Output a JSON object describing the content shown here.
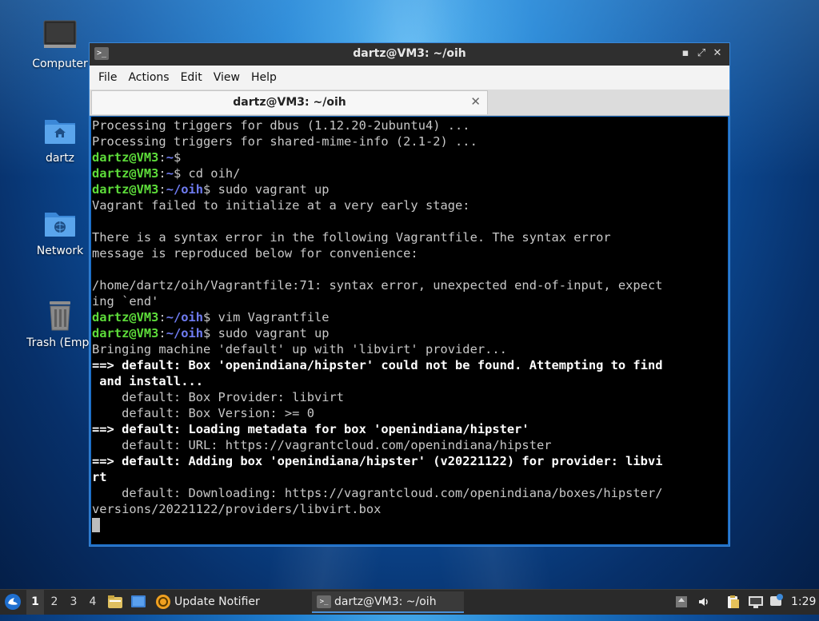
{
  "desktop": {
    "icons": [
      {
        "label": "Computer"
      },
      {
        "label": "dartz"
      },
      {
        "label": "Network"
      },
      {
        "label": "Trash (Empt"
      }
    ]
  },
  "window": {
    "title": "dartz@VM3: ~/oih",
    "buttons": {
      "minimize": "▪",
      "maximize": "⤢",
      "close": "✕"
    },
    "menu": [
      "File",
      "Actions",
      "Edit",
      "View",
      "Help"
    ],
    "tab": {
      "title": "dartz@VM3: ~/oih",
      "close": "✕"
    }
  },
  "terminal": {
    "prompt_user": "dartz@VM3",
    "lines": [
      {
        "t": "Processing triggers for dbus (1.12.20-2ubuntu4) ..."
      },
      {
        "t": "Processing triggers for shared-mime-info (2.1-2) ..."
      },
      {
        "path": "~",
        "cmd": ""
      },
      {
        "path": "~",
        "cmd": " cd oih/"
      },
      {
        "path": "~/oih",
        "cmd": " sudo vagrant up"
      },
      {
        "t": "Vagrant failed to initialize at a very early stage:"
      },
      {
        "t": ""
      },
      {
        "t": "There is a syntax error in the following Vagrantfile. The syntax error"
      },
      {
        "t": "message is reproduced below for convenience:"
      },
      {
        "t": ""
      },
      {
        "t": "/home/dartz/oih/Vagrantfile:71: syntax error, unexpected end-of-input, expect"
      },
      {
        "t": "ing `end'"
      },
      {
        "path": "~/oih",
        "cmd": " vim Vagrantfile"
      },
      {
        "path": "~/oih",
        "cmd": " sudo vagrant up"
      },
      {
        "t": "Bringing machine 'default' up with 'libvirt' provider..."
      },
      {
        "bold": "==> default: Box 'openindiana/hipster' could not be found. Attempting to find"
      },
      {
        "bold": " and install..."
      },
      {
        "t": "    default: Box Provider: libvirt"
      },
      {
        "t": "    default: Box Version: >= 0"
      },
      {
        "bold": "==> default: Loading metadata for box 'openindiana/hipster'"
      },
      {
        "t": "    default: URL: https://vagrantcloud.com/openindiana/hipster"
      },
      {
        "bold": "==> default: Adding box 'openindiana/hipster' (v20221122) for provider: libvi"
      },
      {
        "bold": "rt"
      },
      {
        "t": "    default: Downloading: https://vagrantcloud.com/openindiana/boxes/hipster/"
      },
      {
        "t": "versions/20221122/providers/libvirt.box"
      }
    ]
  },
  "taskbar": {
    "workspaces": [
      "1",
      "2",
      "3",
      "4"
    ],
    "active_workspace": "1",
    "tasks": [
      {
        "label": "Update Notifier"
      },
      {
        "label": "dartz@VM3: ~/oih"
      }
    ],
    "clock": "1:29"
  },
  "colors": {
    "prompt_green": "#5ddc3a",
    "path_blue": "#6f7cf2",
    "terminal_bg": "#000000",
    "accent": "#1e6fc7"
  }
}
